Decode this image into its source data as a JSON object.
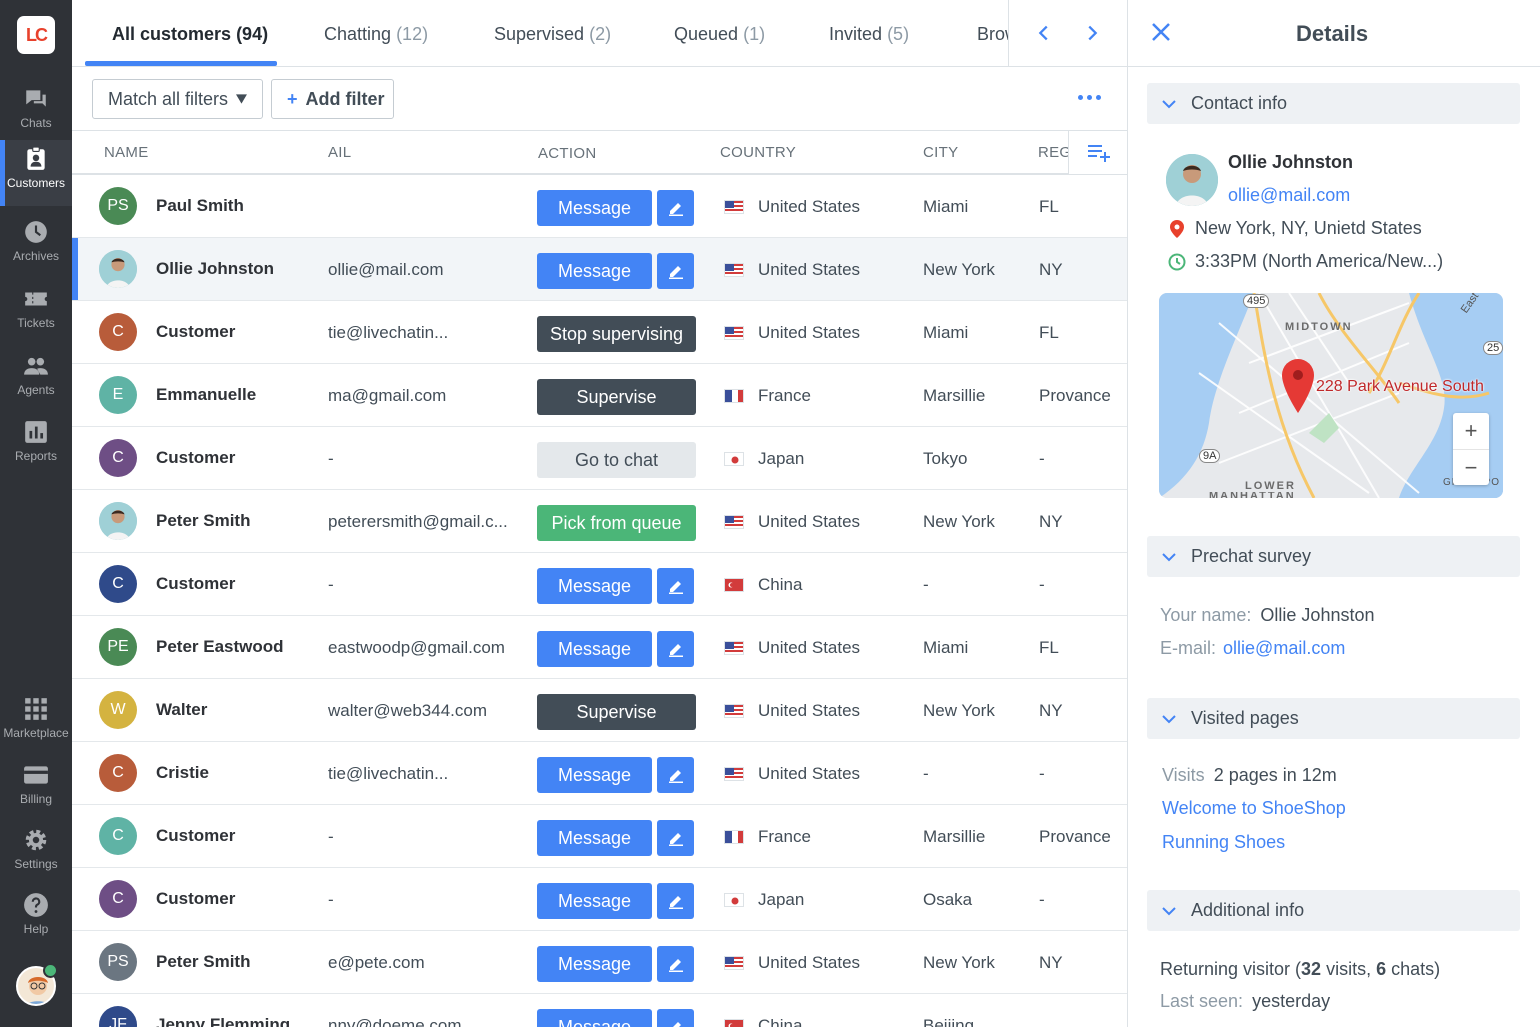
{
  "nav": {
    "logo": "LC",
    "items": [
      {
        "label": "Chats"
      },
      {
        "label": "Customers"
      },
      {
        "label": "Archives"
      },
      {
        "label": "Tickets"
      },
      {
        "label": "Agents"
      },
      {
        "label": "Reports"
      },
      {
        "label": "Marketplace"
      },
      {
        "label": "Billing"
      },
      {
        "label": "Settings"
      },
      {
        "label": "Help"
      }
    ]
  },
  "tabs": [
    {
      "label": "All customers",
      "count": "(94)"
    },
    {
      "label": "Chatting",
      "count": "(12)"
    },
    {
      "label": "Supervised",
      "count": "(2)"
    },
    {
      "label": "Queued",
      "count": "(1)"
    },
    {
      "label": "Invited",
      "count": "(5)"
    },
    {
      "label": "Brow",
      "count": ""
    }
  ],
  "filters": {
    "match": "Match all filters",
    "add": "Add filter"
  },
  "columns": {
    "name": "NAME",
    "email": "AIL",
    "action": "ACTION",
    "country": "COUNTRY",
    "city": "CITY",
    "region": "REG"
  },
  "rows": [
    {
      "initials": "PS",
      "name": "Paul Smith",
      "email": "",
      "action": "Message",
      "country": "United States",
      "city": "Miami",
      "region": "FL"
    },
    {
      "initials": "",
      "name": "Ollie Johnston",
      "email": "ollie@mail.com",
      "action": "Message",
      "country": "United States",
      "city": "New York",
      "region": "NY"
    },
    {
      "initials": "C",
      "name": "Customer",
      "email": "tie@livechatin...",
      "action": "Stop supervising",
      "country": "United States",
      "city": "Miami",
      "region": "FL"
    },
    {
      "initials": "E",
      "name": "Emmanuelle",
      "email": "ma@gmail.com",
      "action": "Supervise",
      "country": "France",
      "city": "Marsillie",
      "region": "Provance"
    },
    {
      "initials": "C",
      "name": "Customer",
      "email": "-",
      "action": "Go to chat",
      "country": "Japan",
      "city": "Tokyo",
      "region": "-"
    },
    {
      "initials": "",
      "name": "Peter Smith",
      "email": "peterersmith@gmail.c...",
      "action": "Pick from queue",
      "country": "United States",
      "city": "New York",
      "region": "NY"
    },
    {
      "initials": "C",
      "name": "Customer",
      "email": "-",
      "action": "Message",
      "country": "China",
      "city": "-",
      "region": "-"
    },
    {
      "initials": "PE",
      "name": "Peter Eastwood",
      "email": "eastwoodp@gmail.com",
      "action": "Message",
      "country": "United States",
      "city": "Miami",
      "region": "FL"
    },
    {
      "initials": "W",
      "name": "Walter",
      "email": "walter@web344.com",
      "action": "Supervise",
      "country": "United States",
      "city": "New York",
      "region": "NY"
    },
    {
      "initials": "C",
      "name": "Cristie",
      "email": "tie@livechatin...",
      "action": "Message",
      "country": "United States",
      "city": "-",
      "region": "-"
    },
    {
      "initials": "C",
      "name": "Customer",
      "email": "-",
      "action": "Message",
      "country": "France",
      "city": "Marsillie",
      "region": "Provance"
    },
    {
      "initials": "C",
      "name": "Customer",
      "email": "-",
      "action": "Message",
      "country": "Japan",
      "city": "Osaka",
      "region": "-"
    },
    {
      "initials": "PS",
      "name": "Peter Smith",
      "email": "e@pete.com",
      "action": "Message",
      "country": "United States",
      "city": "New York",
      "region": "NY"
    },
    {
      "initials": "JF",
      "name": "Jenny Flemming",
      "email": "nny@doeme.com",
      "action": "Message",
      "country": "China",
      "city": "Beijing",
      "region": ""
    }
  ],
  "details": {
    "title": "Details",
    "contact_section": "Contact info",
    "contact_name": "Ollie Johnston",
    "contact_email": "ollie@mail.com",
    "location": "New York, NY, Unietd States",
    "local_time": "3:33PM (North America/New...)",
    "map": {
      "address": "228 Park Avenue South",
      "district1": "MIDTOWN",
      "district2": "LOWER",
      "district3": "MANHATTAN",
      "road1": "495",
      "road2": "9A",
      "road3": "25",
      "corner1": "East",
      "corner2": "GREENPO",
      "zoom_in": "+",
      "zoom_out": "−"
    },
    "prechat_section": "Prechat survey",
    "survey_name_label": "Your name:",
    "survey_name_value": "Ollie Johnston",
    "survey_email_label": "E-mail:",
    "survey_email_value": "ollie@mail.com",
    "visited_section": "Visited pages",
    "visits_label": "Visits",
    "visits_value": "2 pages in 12m",
    "page1": "Welcome to ShoeShop",
    "page2": "Running Shoes",
    "additional_section": "Additional info",
    "returning_prefix": "Returning visitor (",
    "returning_visits": "32",
    "returning_visits_word": " visits, ",
    "returning_chats": "6",
    "returning_chats_word": " chats)",
    "last_seen_label": "Last seen:",
    "last_seen_value": "yesterday"
  },
  "colors": {
    "accent": "#4384f5",
    "dark_button": "#424d57",
    "green_button": "#4bb678",
    "nav_bg": "#2f3237"
  }
}
